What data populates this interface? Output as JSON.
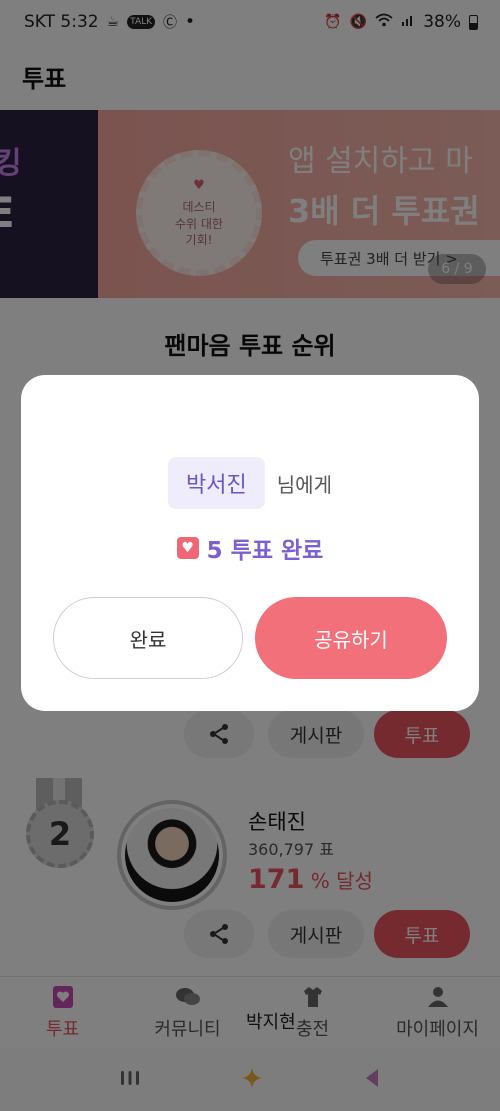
{
  "status_bar": {
    "carrier_time": "SKT 5:32",
    "talk_badge": "TALK",
    "dot": "•",
    "battery": "38%"
  },
  "header": {
    "title": "투표"
  },
  "banner": {
    "left_line1": "킹",
    "left_line2": "E",
    "badge_line1": "데스티",
    "badge_line2": "수위 대한",
    "badge_line3": "기회!",
    "headline1": "앱 설치하고 마",
    "headline2": "3배 더 투표권",
    "button_label": "투표권 3배 더 받기 >",
    "counter": "6 / 9"
  },
  "section_title": "팬마음 투표 순위",
  "rank_actions": {
    "board_label": "게시판",
    "vote_label": "투표"
  },
  "rank_item": {
    "rank": "2",
    "name": "손태진",
    "votes": "360,797 표",
    "percent_value": "171",
    "percent_suffix": "% 달성"
  },
  "peek_name": "박지현",
  "bottom_nav": [
    {
      "label": "투표",
      "icon": "vote-icon"
    },
    {
      "label": "커뮤니티",
      "icon": "chat-icon"
    },
    {
      "label": "충전",
      "icon": "charge-icon"
    },
    {
      "label": "마이페이지",
      "icon": "person-icon"
    }
  ],
  "modal": {
    "recipient": "박서진",
    "recipient_suffix": "님에게",
    "result": "5 투표 완료",
    "done_label": "완료",
    "share_label": "공유하기"
  },
  "colors": {
    "accent": "#e8545f",
    "share_button": "#f2707a",
    "recipient_text": "#6c55c8",
    "result_text": "#7d5fd0"
  }
}
